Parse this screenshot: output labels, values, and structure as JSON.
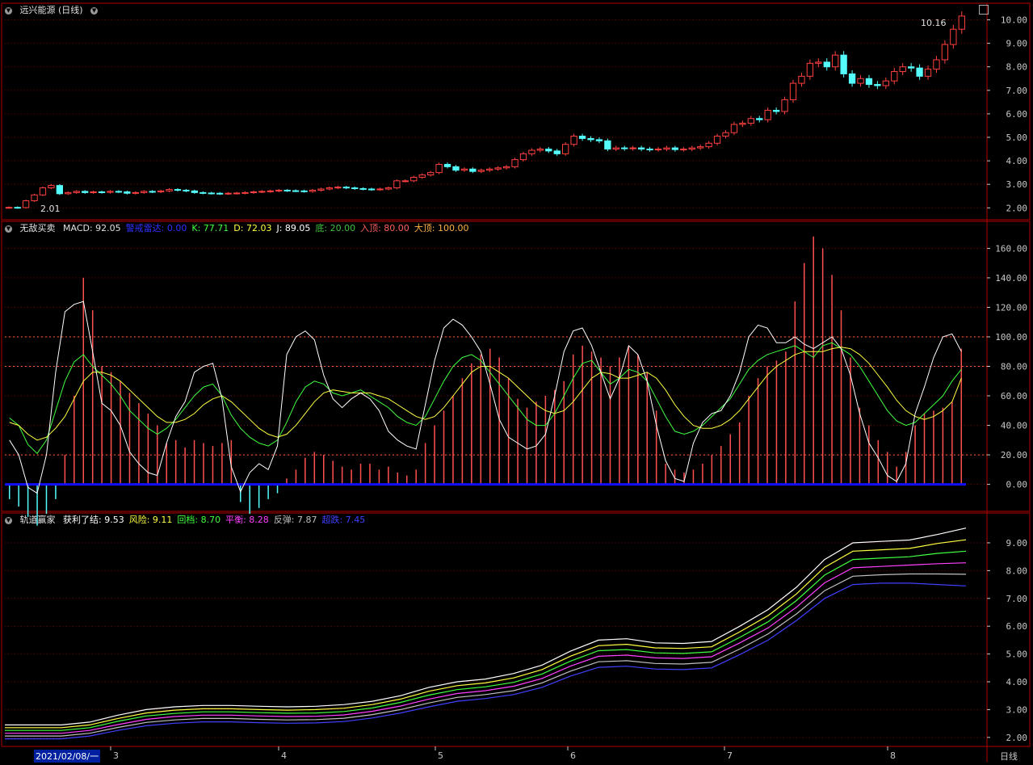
{
  "main": {
    "title": "远兴能源 (日线)",
    "high_label": "10.16",
    "low_label": "2.01"
  },
  "macd": {
    "name": "无敌买卖",
    "items": [
      {
        "label": "MACD",
        "value": "92.05",
        "color": "#e0e0e0"
      },
      {
        "label": "警戒雷达",
        "value": "0.00",
        "color": "#3030ff"
      },
      {
        "label": "K",
        "value": "77.71",
        "color": "#40ff40"
      },
      {
        "label": "D",
        "value": "72.03",
        "color": "#ffff40"
      },
      {
        "label": "J",
        "value": "89.05",
        "color": "#ffffff"
      },
      {
        "label": "底",
        "value": "20.00",
        "color": "#40c040"
      },
      {
        "label": "入顶",
        "value": "80.00",
        "color": "#ff6060"
      },
      {
        "label": "大顶",
        "value": "100.00",
        "color": "#ffb040"
      }
    ]
  },
  "channel": {
    "name": "轨道赢家",
    "items": [
      {
        "label": "获利了结",
        "value": "9.53",
        "color": "#ffffff"
      },
      {
        "label": "风险",
        "value": "9.11",
        "color": "#ffff40"
      },
      {
        "label": "回档",
        "value": "8.70",
        "color": "#40ff40"
      },
      {
        "label": "平衡",
        "value": "8.28",
        "color": "#ff40ff"
      },
      {
        "label": "反弹",
        "value": "7.87",
        "color": "#c0c0c0"
      },
      {
        "label": "超跌",
        "value": "7.45",
        "color": "#4040ff"
      }
    ]
  },
  "time_axis": {
    "start_label": "2021/02/08/一",
    "months": [
      "3",
      "4",
      "5",
      "6",
      "7",
      "8"
    ],
    "period_label": "日线"
  },
  "colors": {
    "up": "#ff4040",
    "down": "#54fcfc",
    "border": "#b00000",
    "grid": "#800000",
    "zero_line": "#1010ff"
  },
  "chart_data": [
    {
      "type": "candlestick",
      "title": "远兴能源 (日线)",
      "ylim": [
        1.7,
        10.5
      ],
      "y_ticks": [
        "2.00",
        "3.00",
        "4.00",
        "5.00",
        "6.00",
        "7.00",
        "8.00",
        "9.00",
        "10.00"
      ],
      "close": [
        2.02,
        2.01,
        2.3,
        2.55,
        2.85,
        2.95,
        2.6,
        2.65,
        2.7,
        2.65,
        2.68,
        2.66,
        2.7,
        2.68,
        2.62,
        2.65,
        2.7,
        2.68,
        2.72,
        2.78,
        2.75,
        2.72,
        2.65,
        2.63,
        2.62,
        2.6,
        2.62,
        2.63,
        2.65,
        2.68,
        2.7,
        2.72,
        2.75,
        2.73,
        2.72,
        2.7,
        2.75,
        2.8,
        2.85,
        2.88,
        2.85,
        2.82,
        2.8,
        2.78,
        2.8,
        2.85,
        3.15,
        3.15,
        3.3,
        3.4,
        3.5,
        3.85,
        3.75,
        3.6,
        3.65,
        3.55,
        3.6,
        3.65,
        3.7,
        3.75,
        4.05,
        4.3,
        4.45,
        4.5,
        4.42,
        4.3,
        4.7,
        5.05,
        4.95,
        4.9,
        4.85,
        4.5,
        4.55,
        4.52,
        4.55,
        4.5,
        4.48,
        4.5,
        4.55,
        4.48,
        4.5,
        4.55,
        4.6,
        4.75,
        5.05,
        5.2,
        5.55,
        5.6,
        5.8,
        5.75,
        6.15,
        6.1,
        6.6,
        7.3,
        7.6,
        8.15,
        8.2,
        8.0,
        8.5,
        7.7,
        7.3,
        7.5,
        7.25,
        7.2,
        7.4,
        7.8,
        8.0,
        7.95,
        7.6,
        7.9,
        8.3,
        8.95,
        9.6,
        10.16
      ],
      "x_month_labels": [
        "3",
        "4",
        "5",
        "6",
        "7",
        "8"
      ]
    },
    {
      "type": "line",
      "title": "无敌买卖",
      "ylim": [
        -15,
        175
      ],
      "y_ticks": [
        "0.00",
        "20.00",
        "40.00",
        "60.00",
        "80.00",
        "100.00",
        "120.00",
        "140.00",
        "160.00"
      ],
      "reference_lines": [
        20,
        80,
        100
      ],
      "series": [
        {
          "name": "K",
          "values": [
            45,
            40,
            27,
            21,
            30,
            50,
            70,
            83,
            88,
            80,
            74,
            68,
            60,
            50,
            44,
            38,
            34,
            38,
            44,
            52,
            60,
            66,
            68,
            60,
            47,
            38,
            32,
            28,
            26,
            30,
            42,
            56,
            66,
            70,
            68,
            62,
            60,
            62,
            64,
            60,
            56,
            52,
            46,
            42,
            40,
            46,
            58,
            70,
            80,
            86,
            88,
            84,
            76,
            68,
            60,
            52,
            44,
            40,
            40,
            48,
            60,
            72,
            82,
            84,
            76,
            68,
            72,
            78,
            76,
            70,
            58,
            46,
            36,
            34,
            36,
            40,
            46,
            52,
            58,
            68,
            78,
            84,
            88,
            90,
            92,
            94,
            90,
            86,
            94,
            96,
            92,
            88,
            80,
            70,
            60,
            50,
            43,
            40,
            42,
            48,
            54,
            60,
            70,
            78
          ]
        },
        {
          "name": "D",
          "values": [
            42,
            40,
            34,
            30,
            32,
            38,
            46,
            58,
            70,
            76,
            76,
            74,
            70,
            64,
            58,
            52,
            46,
            42,
            42,
            44,
            48,
            54,
            58,
            60,
            56,
            50,
            44,
            38,
            34,
            32,
            34,
            40,
            48,
            56,
            62,
            64,
            63,
            62,
            62,
            62,
            60,
            58,
            54,
            50,
            46,
            44,
            46,
            52,
            60,
            68,
            76,
            80,
            80,
            76,
            72,
            66,
            60,
            54,
            50,
            48,
            50,
            56,
            64,
            72,
            76,
            75,
            72,
            72,
            74,
            76,
            72,
            64,
            54,
            46,
            40,
            38,
            38,
            40,
            44,
            50,
            58,
            66,
            74,
            80,
            84,
            88,
            90,
            90,
            90,
            92,
            93,
            92,
            88,
            82,
            74,
            66,
            57,
            50,
            46,
            44,
            46,
            50,
            56,
            72
          ]
        },
        {
          "name": "J",
          "values": [
            30,
            20,
            -2,
            -6,
            20,
            76,
            117,
            122,
            124,
            90,
            55,
            50,
            40,
            22,
            14,
            8,
            6,
            28,
            46,
            56,
            76,
            80,
            82,
            58,
            12,
            -5,
            8,
            14,
            10,
            26,
            88,
            100,
            104,
            98,
            74,
            58,
            52,
            58,
            62,
            58,
            50,
            36,
            30,
            26,
            24,
            54,
            84,
            106,
            112,
            108,
            100,
            90,
            68,
            44,
            32,
            28,
            24,
            26,
            34,
            60,
            90,
            104,
            106,
            94,
            76,
            58,
            72,
            94,
            88,
            70,
            40,
            16,
            4,
            2,
            28,
            42,
            48,
            50,
            60,
            76,
            100,
            108,
            106,
            96,
            96,
            100,
            95,
            92,
            96,
            100,
            92,
            74,
            48,
            28,
            18,
            6,
            2,
            14,
            48,
            66,
            86,
            100,
            102,
            90
          ]
        },
        {
          "name": "MACD",
          "values": [
            -10,
            -15,
            -22,
            -28,
            -20,
            -10,
            20,
            60,
            140,
            118,
            80,
            76,
            70,
            62,
            55,
            48,
            40,
            28,
            30,
            25,
            30,
            28,
            26,
            28,
            30,
            -12,
            -20,
            -16,
            -10,
            -6,
            4,
            10,
            18,
            22,
            20,
            16,
            12,
            10,
            14,
            14,
            10,
            12,
            8,
            6,
            10,
            28,
            40,
            50,
            60,
            72,
            82,
            88,
            92,
            86,
            72,
            58,
            52,
            56,
            60,
            64,
            70,
            88,
            94,
            90,
            86,
            80,
            86,
            94,
            88,
            76,
            50,
            14,
            10,
            8,
            10,
            14,
            20,
            26,
            34,
            42,
            60,
            72,
            80,
            84,
            90,
            124,
            150,
            168,
            160,
            142,
            118,
            86,
            52,
            40,
            30,
            22,
            12,
            22,
            40,
            48,
            50,
            52,
            56,
            92
          ]
        }
      ]
    },
    {
      "type": "line",
      "title": "轨道赢家",
      "ylim": [
        1.85,
        9.9
      ],
      "y_ticks": [
        "2.00",
        "3.00",
        "4.00",
        "5.00",
        "6.00",
        "7.00",
        "8.00",
        "9.00"
      ],
      "series": [
        {
          "name": "获利了结",
          "values": [
            2.45,
            2.45,
            2.45,
            2.55,
            2.8,
            3.0,
            3.1,
            3.15,
            3.15,
            3.12,
            3.1,
            3.12,
            3.18,
            3.3,
            3.5,
            3.8,
            4.0,
            4.1,
            4.3,
            4.6,
            5.1,
            5.5,
            5.55,
            5.4,
            5.38,
            5.45,
            6.0,
            6.6,
            7.4,
            8.4,
            9.0,
            9.05,
            9.1,
            9.3,
            9.53
          ]
        },
        {
          "name": "风险",
          "values": [
            2.35,
            2.35,
            2.35,
            2.45,
            2.68,
            2.88,
            2.98,
            3.03,
            3.03,
            3.0,
            2.98,
            3.0,
            3.05,
            3.18,
            3.38,
            3.66,
            3.86,
            3.96,
            4.14,
            4.44,
            4.92,
            5.3,
            5.35,
            5.22,
            5.2,
            5.26,
            5.8,
            6.38,
            7.16,
            8.12,
            8.7,
            8.75,
            8.8,
            8.98,
            9.11
          ]
        },
        {
          "name": "回档",
          "values": [
            2.25,
            2.25,
            2.25,
            2.35,
            2.58,
            2.77,
            2.86,
            2.92,
            2.92,
            2.89,
            2.87,
            2.88,
            2.93,
            3.06,
            3.26,
            3.52,
            3.72,
            3.82,
            3.98,
            4.28,
            4.74,
            5.12,
            5.16,
            5.04,
            5.02,
            5.08,
            5.6,
            6.16,
            6.92,
            7.84,
            8.4,
            8.45,
            8.5,
            8.62,
            8.7
          ]
        },
        {
          "name": "平衡",
          "values": [
            2.15,
            2.15,
            2.15,
            2.25,
            2.46,
            2.65,
            2.75,
            2.8,
            2.8,
            2.77,
            2.75,
            2.76,
            2.81,
            2.94,
            3.13,
            3.38,
            3.58,
            3.68,
            3.84,
            4.12,
            4.56,
            4.92,
            4.96,
            4.86,
            4.84,
            4.9,
            5.4,
            5.94,
            6.68,
            7.56,
            8.1,
            8.15,
            8.2,
            8.25,
            8.28
          ]
        },
        {
          "name": "反弹",
          "values": [
            2.05,
            2.05,
            2.05,
            2.15,
            2.36,
            2.54,
            2.63,
            2.68,
            2.68,
            2.65,
            2.63,
            2.64,
            2.69,
            2.82,
            3.0,
            3.24,
            3.44,
            3.54,
            3.68,
            3.96,
            4.38,
            4.72,
            4.76,
            4.66,
            4.64,
            4.7,
            5.18,
            5.72,
            6.44,
            7.28,
            7.8,
            7.85,
            7.88,
            7.88,
            7.87
          ]
        },
        {
          "name": "超跌",
          "values": [
            1.95,
            1.95,
            1.95,
            2.05,
            2.25,
            2.42,
            2.51,
            2.56,
            2.56,
            2.53,
            2.51,
            2.52,
            2.57,
            2.7,
            2.88,
            3.1,
            3.3,
            3.4,
            3.54,
            3.8,
            4.2,
            4.52,
            4.56,
            4.46,
            4.44,
            4.5,
            4.98,
            5.5,
            6.2,
            7.0,
            7.5,
            7.55,
            7.55,
            7.5,
            7.45
          ]
        }
      ]
    }
  ]
}
